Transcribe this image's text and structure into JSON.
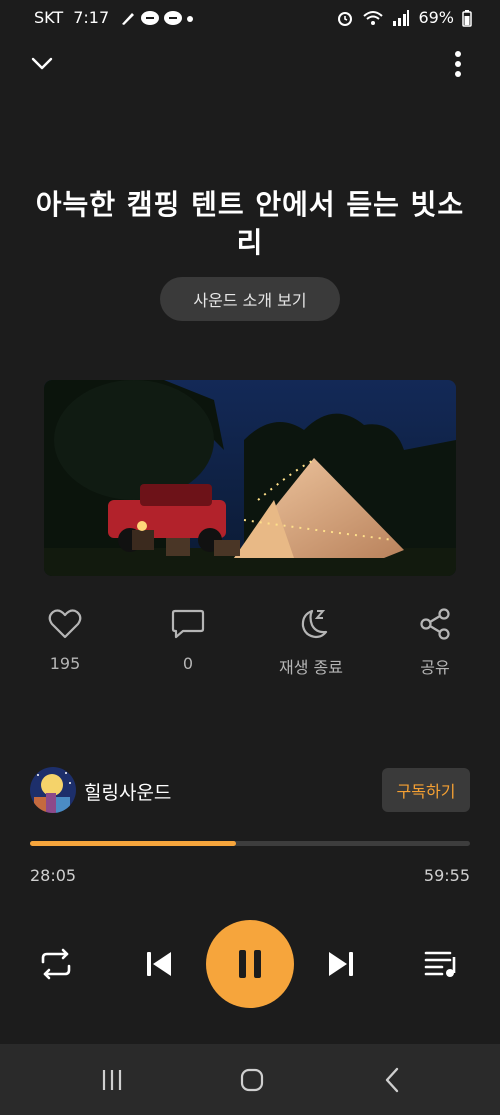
{
  "status": {
    "carrier": "SKT",
    "time": "7:17",
    "battery": "69%"
  },
  "track": {
    "title": "아늑한 캠핑 텐트 안에서 듣는 빗소리",
    "intro_button": "사운드 소개 보기"
  },
  "actions": {
    "like_count": "195",
    "comment_count": "0",
    "sleep_timer_label": "재생 종료",
    "share_label": "공유"
  },
  "channel": {
    "name": "힐링사운드",
    "subscribe_label": "구독하기"
  },
  "player": {
    "current_time": "28:05",
    "total_time": "59:55",
    "progress": 0.468,
    "state": "playing"
  },
  "colors": {
    "accent": "#f6a53c",
    "background": "#1c1c1c",
    "button_bg": "#3a3a3a"
  },
  "icons": {
    "collapse": "chevron-down-icon",
    "more": "more-vertical-icon",
    "like": "heart-icon",
    "comment": "comment-icon",
    "sleep": "moon-icon",
    "share": "share-icon",
    "repeat": "repeat-icon",
    "previous": "skip-previous-icon",
    "pause": "pause-icon",
    "next": "skip-next-icon",
    "playlist": "playlist-icon"
  }
}
